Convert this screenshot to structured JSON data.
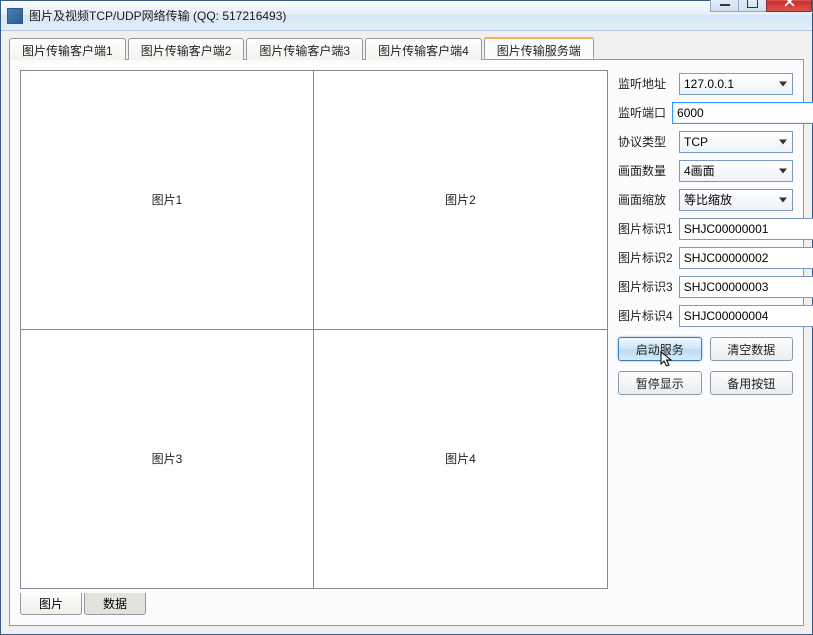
{
  "window": {
    "title": "图片及视频TCP/UDP网络传输 (QQ: 517216493)"
  },
  "topTabs": [
    "图片传输客户端1",
    "图片传输客户端2",
    "图片传输客户端3",
    "图片传输客户端4",
    "图片传输服务端"
  ],
  "topTabActiveIndex": 4,
  "preview": {
    "cells": [
      "图片1",
      "图片2",
      "图片3",
      "图片4"
    ]
  },
  "bottomTabs": [
    "图片",
    "数据"
  ],
  "bottomTabActiveIndex": 1,
  "form": {
    "listenAddr": {
      "label": "监听地址",
      "value": "127.0.0.1",
      "type": "combo"
    },
    "listenPort": {
      "label": "监听端口",
      "value": "6000",
      "type": "text",
      "focused": true
    },
    "protocol": {
      "label": "协议类型",
      "value": "TCP",
      "type": "combo"
    },
    "gridCount": {
      "label": "画面数量",
      "value": "4画面",
      "type": "combo"
    },
    "scaleMode": {
      "label": "画面缩放",
      "value": "等比缩放",
      "type": "combo"
    },
    "imgId1": {
      "label": "图片标识1",
      "value": "SHJC00000001",
      "type": "text"
    },
    "imgId2": {
      "label": "图片标识2",
      "value": "SHJC00000002",
      "type": "text"
    },
    "imgId3": {
      "label": "图片标识3",
      "value": "SHJC00000003",
      "type": "text"
    },
    "imgId4": {
      "label": "图片标识4",
      "value": "SHJC00000004",
      "type": "text"
    }
  },
  "buttons": {
    "startService": "启动服务",
    "clearData": "清空数据",
    "pauseDisplay": "暂停显示",
    "spareButton": "备用按钮"
  }
}
